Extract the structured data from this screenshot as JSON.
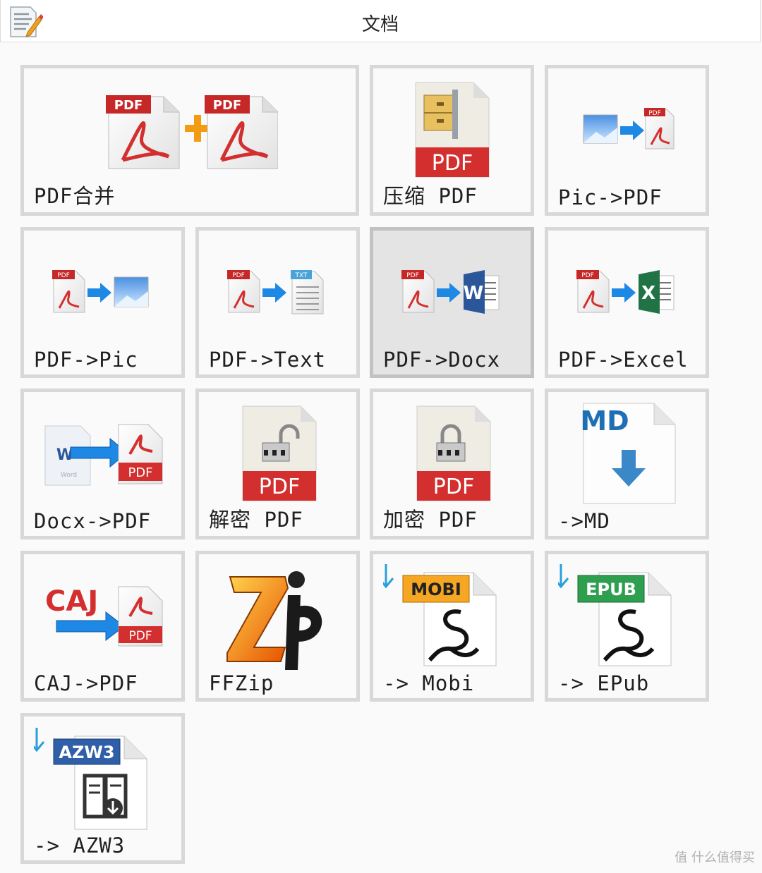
{
  "window": {
    "title": "文档"
  },
  "tiles": [
    {
      "label": "PDF合并"
    },
    {
      "label": "压缩 PDF"
    },
    {
      "label": "Pic->PDF"
    },
    {
      "label": "PDF->Pic"
    },
    {
      "label": "PDF->Text"
    },
    {
      "label": "PDF->Docx"
    },
    {
      "label": "PDF->Excel"
    },
    {
      "label": "Docx->PDF"
    },
    {
      "label": "解密 PDF"
    },
    {
      "label": "加密 PDF"
    },
    {
      "label": "->MD"
    },
    {
      "label": "CAJ->PDF"
    },
    {
      "label": "FFZip"
    },
    {
      "label": "-> Mobi"
    },
    {
      "label": "-> EPub"
    },
    {
      "label": "-> AZW3"
    }
  ],
  "icons": {
    "pdf_badge": "PDF",
    "txt_badge": "TXT",
    "word_letter": "W",
    "excel_letter": "X",
    "word_small": "Word",
    "md_text": "MD",
    "caj_text": "CAJ",
    "mobi_text": "MOBI",
    "epub_text": "EPUB",
    "azw3_text": "AZW3"
  },
  "colors": {
    "pdf_red": "#d32f2f",
    "plus_orange": "#f39c12",
    "arrow_blue": "#1e88e5",
    "word_blue": "#2b579a",
    "excel_green": "#217346",
    "mobi_orange": "#f5a623",
    "epub_green": "#2e9e4f",
    "azw3_blue": "#2f5fa8"
  },
  "watermark": "值 什么值得买"
}
